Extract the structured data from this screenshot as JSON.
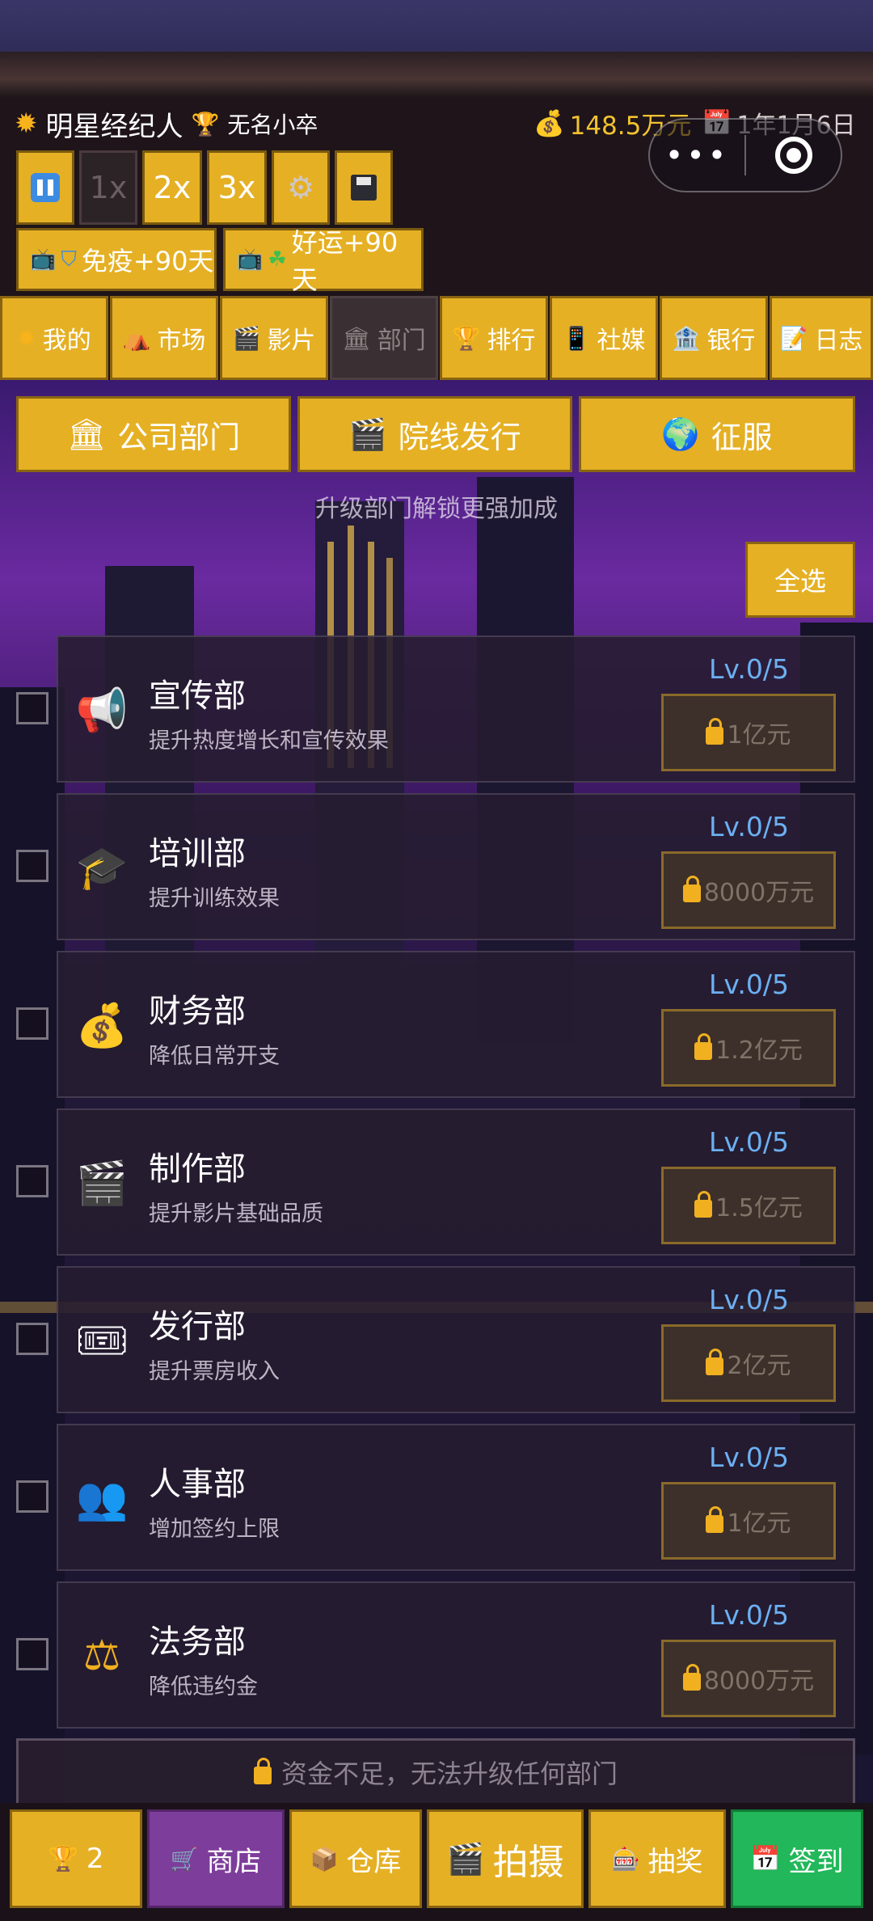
{
  "header": {
    "game_title": "明星经纪人",
    "rank": "无名小卒",
    "money": "148.5万元",
    "date": "1年1月6日"
  },
  "speed_controls": [
    "1x",
    "2x",
    "3x"
  ],
  "buffs": [
    "免疫+90天",
    "好运+90天"
  ],
  "nav_tabs": [
    {
      "label": "我的",
      "icon": "sun-icon"
    },
    {
      "label": "市场",
      "icon": "tent-icon"
    },
    {
      "label": "影片",
      "icon": "clapper-icon"
    },
    {
      "label": "部门",
      "icon": "building-icon",
      "active": true
    },
    {
      "label": "排行",
      "icon": "trophy-icon"
    },
    {
      "label": "社媒",
      "icon": "phone-icon"
    },
    {
      "label": "银行",
      "icon": "bank-icon"
    },
    {
      "label": "日志",
      "icon": "memo-icon"
    }
  ],
  "section_buttons": [
    "公司部门",
    "院线发行",
    "征服"
  ],
  "hint": "升级部门解锁更强加成",
  "select_all": "全选",
  "departments": [
    {
      "name": "宣传部",
      "desc": "提升热度增长和宣传效果",
      "level": "Lv.0/5",
      "price": "1亿元",
      "icon": "megaphone-icon"
    },
    {
      "name": "培训部",
      "desc": "提升训练效果",
      "level": "Lv.0/5",
      "price": "8000万元",
      "icon": "graduation-cap-icon"
    },
    {
      "name": "财务部",
      "desc": "降低日常开支",
      "level": "Lv.0/5",
      "price": "1.2亿元",
      "icon": "money-bag-icon"
    },
    {
      "name": "制作部",
      "desc": "提升影片基础品质",
      "level": "Lv.0/5",
      "price": "1.5亿元",
      "icon": "clapper-icon"
    },
    {
      "name": "发行部",
      "desc": "提升票房收入",
      "level": "Lv.0/5",
      "price": "2亿元",
      "icon": "ticket-icon"
    },
    {
      "name": "人事部",
      "desc": "增加签约上限",
      "level": "Lv.0/5",
      "price": "1亿元",
      "icon": "people-icon"
    },
    {
      "name": "法务部",
      "desc": "降低违约金",
      "level": "Lv.0/5",
      "price": "8000万元",
      "icon": "scales-icon"
    }
  ],
  "notice": "资金不足，无法升级任何部门",
  "bottom_bar": {
    "trophy_count": "2",
    "shop": "商店",
    "warehouse": "仓库",
    "shoot": "拍摄",
    "lottery": "抽奖",
    "checkin": "签到"
  },
  "colors": {
    "accent": "#e5b024",
    "level": "#6cb0f2",
    "shop": "#7d3d9a",
    "checkin": "#22b75a"
  }
}
